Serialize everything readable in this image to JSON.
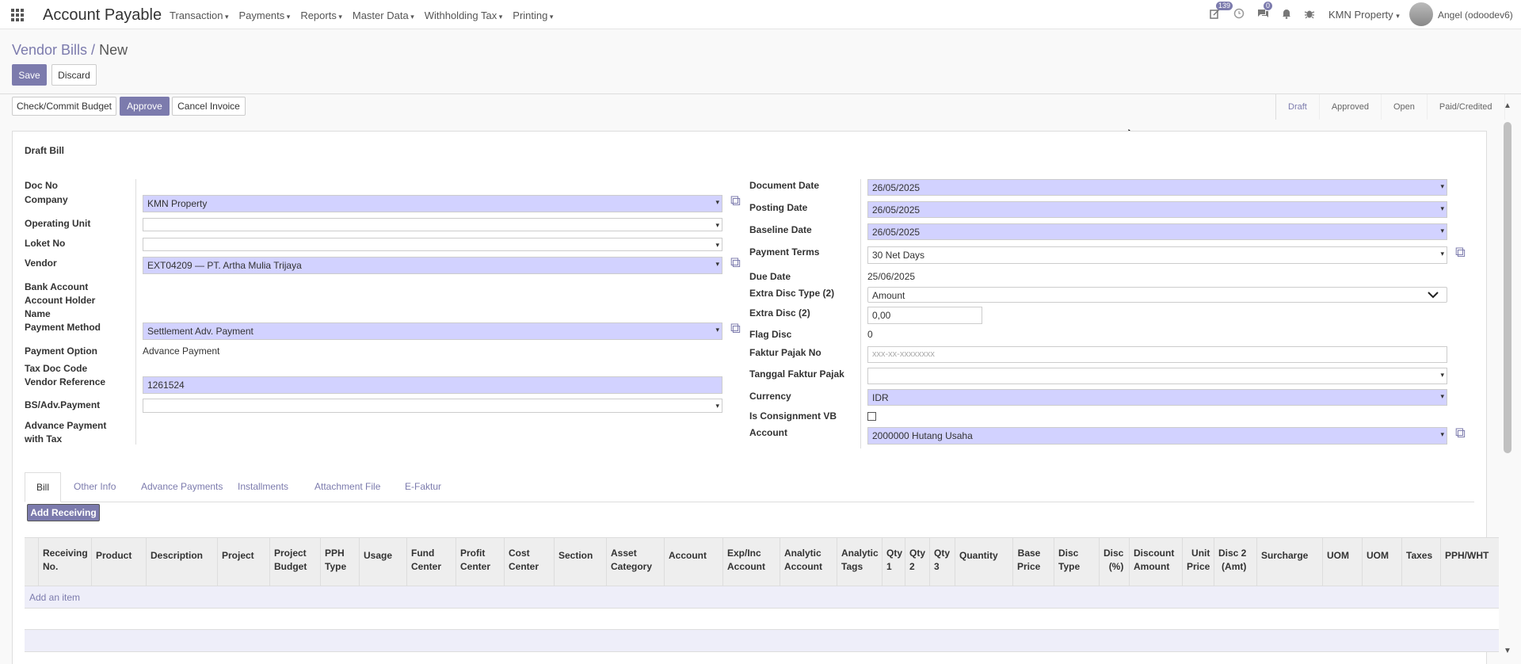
{
  "app": {
    "title": "Account Payable",
    "menu": [
      "Transaction",
      "Payments",
      "Reports",
      "Master Data",
      "Withholding Tax",
      "Printing"
    ],
    "activity_badge": "139",
    "chat_badge": "0",
    "company": "KMN Property",
    "user": "Angel (odoodev6)"
  },
  "breadcrumb": {
    "parent": "Vendor Bills /",
    "current": "New"
  },
  "buttons": {
    "save": "Save",
    "discard": "Discard",
    "budget": "Check/Commit Budget",
    "approve": "Approve",
    "cancel": "Cancel Invoice",
    "add_receiving": "Add Receiving",
    "add_item": "Add an item"
  },
  "statusbar": [
    "Draft",
    "Approved",
    "Open",
    "Paid/Credited"
  ],
  "form": {
    "heading": "Draft Bill",
    "left_labels": {
      "doc_no": "Doc No",
      "company": "Company",
      "operating_unit": "Operating Unit",
      "loket_no": "Loket No",
      "vendor": "Vendor",
      "bank_account": "Bank Account",
      "holder1": "Account Holder",
      "holder2": "Name",
      "payment_method": "Payment Method",
      "payment_option": "Payment Option",
      "tax_doc": "Tax Doc Code",
      "vendor_ref": "Vendor Reference",
      "bs_adv": "BS/Adv.Payment",
      "adv_tax1": "Advance Payment",
      "adv_tax2": "with Tax"
    },
    "left_values": {
      "company": "KMN Property",
      "vendor": "EXT04209 — PT. Artha Mulia Trijaya",
      "payment_method": "Settlement Adv. Payment",
      "payment_option": "Advance Payment",
      "vendor_ref": "1261524"
    },
    "right_labels": {
      "doc_date": "Document Date",
      "posting_date": "Posting Date",
      "baseline_date": "Baseline Date",
      "payment_terms": "Payment Terms",
      "due_date": "Due Date",
      "disc_type": "Extra Disc Type (2)",
      "disc": "Extra Disc (2)",
      "flag_disc": "Flag Disc",
      "faktur_no": "Faktur Pajak No",
      "faktur_date": "Tanggal Faktur Pajak",
      "currency": "Currency",
      "consignment": "Is Consignment VB",
      "account": "Account"
    },
    "right_values": {
      "doc_date": "26/05/2025",
      "posting_date": "26/05/2025",
      "baseline_date": "26/05/2025",
      "payment_terms": "30 Net Days",
      "due_date": "25/06/2025",
      "disc_type": "Amount",
      "disc": "0,00",
      "flag_disc": "0",
      "faktur_placeholder": "xxx-xx-xxxxxxxx",
      "currency": "IDR",
      "account": "2000000 Hutang Usaha"
    }
  },
  "tabs": [
    "Bill",
    "Other Info",
    "Advance Payments",
    "Installments",
    "Attachment File",
    "E-Faktur"
  ],
  "columns": [
    [
      "Receiving",
      "No."
    ],
    [
      "Product"
    ],
    [
      "Description"
    ],
    [
      "Project"
    ],
    [
      "Project",
      "Budget"
    ],
    [
      "PPH",
      "Type"
    ],
    [
      "Usage"
    ],
    [
      "Fund",
      "Center"
    ],
    [
      "Profit",
      "Center"
    ],
    [
      "Cost",
      "Center"
    ],
    [
      "Section"
    ],
    [
      "Asset",
      "Category"
    ],
    [
      "Account"
    ],
    [
      "Exp/Inc",
      "Account"
    ],
    [
      "Analytic",
      "Account"
    ],
    [
      "Analytic",
      "Tags"
    ],
    [
      "Qty",
      "1"
    ],
    [
      "Qty",
      "2"
    ],
    [
      "Qty",
      "3"
    ],
    [
      "Quantity"
    ],
    [
      "Base",
      "Price"
    ],
    [
      "Disc",
      "Type"
    ],
    [
      "Disc",
      "(%)"
    ],
    [
      "Discount",
      "Amount"
    ],
    [
      "Unit",
      "Price"
    ],
    [
      "Disc 2",
      "(Amt)"
    ],
    [
      "Surcharge"
    ],
    [
      "UOM"
    ],
    [
      "UOM"
    ],
    [
      "Taxes"
    ],
    [
      "PPH/WHT"
    ]
  ]
}
